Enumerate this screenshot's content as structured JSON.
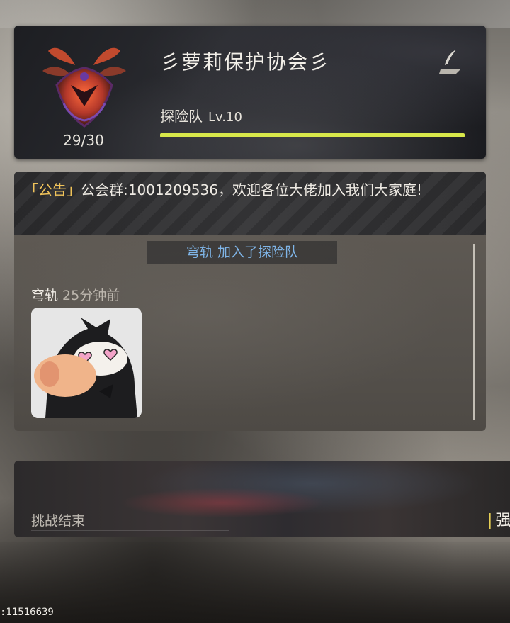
{
  "guild": {
    "name": "彡萝莉保护协会彡",
    "member_count": "29/30",
    "type_label": "探险队",
    "level": "Lv.10",
    "xp_fraction": 1.0,
    "xp_color": "#d8e84a",
    "emblem_icon": "demon-crest-icon",
    "edit_icon": "quill-icon"
  },
  "notice": {
    "tag": "「公告」",
    "text": "公会群:1001209536，欢迎各位大佬加入我们大家庭!"
  },
  "chat": {
    "system_message": "穹轨 加入了探险队",
    "messages": [
      {
        "sender": "穹轨",
        "time": "25分钟前",
        "sticker_icon": "blushing-cat-sticker"
      }
    ]
  },
  "challenge": {
    "status": "挑战结束",
    "edge_label": "强"
  },
  "footer": {
    "uid": ":11516639"
  },
  "colors": {
    "system_message": "#7fb5e8",
    "notice_tag": "#f0c35a"
  }
}
